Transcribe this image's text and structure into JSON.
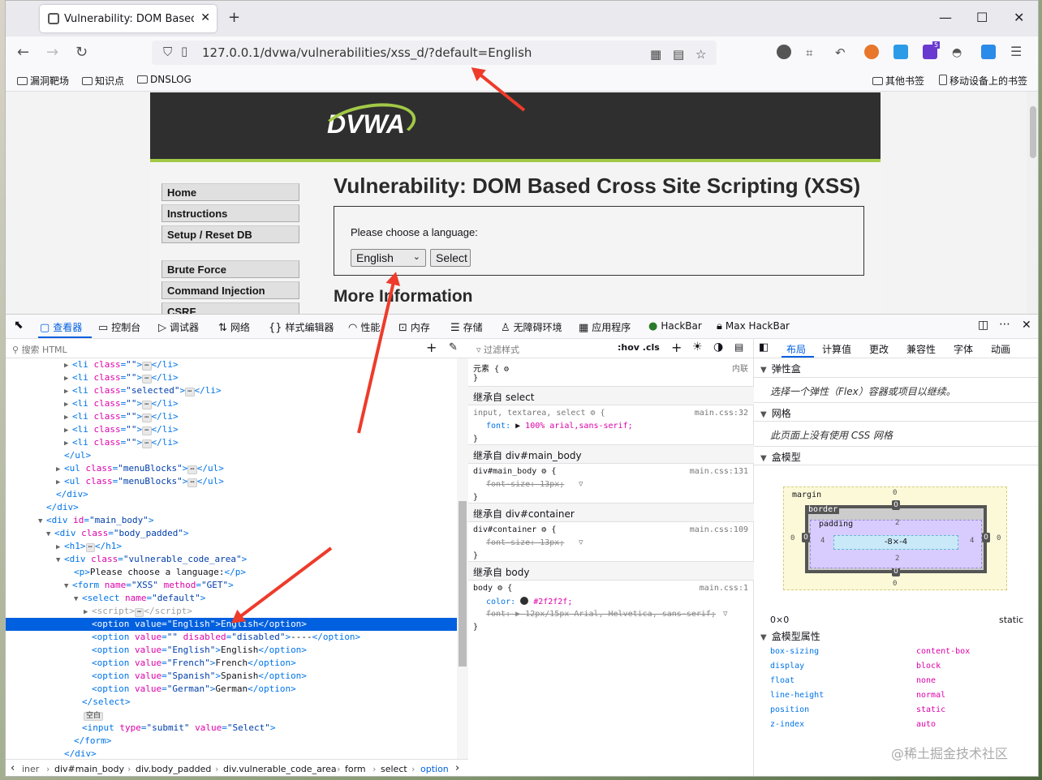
{
  "browser": {
    "tab_title": "Vulnerability: DOM Based Cross Site Scripting (XSS)",
    "url": "127.0.0.1/dvwa/vulnerabilities/xss_d/?default=English",
    "bookmarks": [
      "漏洞靶场",
      "知识点",
      "DNSLOG"
    ],
    "bookmarks_right": [
      "其他书签",
      "移动设备上的书签"
    ],
    "ext_badge": "5"
  },
  "dvwa": {
    "logo": "DVWA",
    "menu": [
      "Home",
      "Instructions",
      "Setup / Reset DB",
      "Brute Force",
      "Command Injection",
      "CSRF"
    ],
    "heading": "Vulnerability: DOM Based Cross Site Scripting (XSS)",
    "prompt": "Please choose a language:",
    "select_value": "English",
    "select_button": "Select",
    "more_info": "More Information"
  },
  "devtools": {
    "tabs": [
      "查看器",
      "控制台",
      "调试器",
      "网络",
      "样式编辑器",
      "性能",
      "内存",
      "存储",
      "无障碍环境",
      "应用程序",
      "HackBar",
      "Max HackBar"
    ],
    "search_placeholder": "搜索 HTML",
    "tree": [
      {
        "indent": 7,
        "tri": "▶",
        "html": "li_class_empty"
      },
      {
        "indent": 7,
        "tri": "▶",
        "html": "li_class_empty"
      },
      {
        "indent": 7,
        "tri": "▶",
        "html": "li_class_selected"
      },
      {
        "indent": 7,
        "tri": "▶",
        "html": "li_class_empty"
      },
      {
        "indent": 7,
        "tri": "▶",
        "html": "li_class_empty"
      },
      {
        "indent": 7,
        "tri": "▶",
        "html": "li_class_empty"
      },
      {
        "indent": 7,
        "tri": "▶",
        "html": "li_class_empty"
      }
    ],
    "tree_lines": [
      "<li class=\"\">",
      "<li class=\"\">",
      "<li class=\"selected\">",
      "<li class=\"\">",
      "<li class=\"\">",
      "<li class=\"\">",
      "<li class=\"\">",
      "</ul>",
      "<ul class=\"menuBlocks\">",
      "<ul class=\"menuBlocks\">",
      "</div>",
      "</div>",
      "<div id=\"main_body\">",
      "<div class=\"body_padded\">",
      "<h1>",
      "<div class=\"vulnerable_code_area\">",
      "<p>Please choose a language:</p>",
      "<form name=\"XSS\" method=\"GET\">",
      "<select name=\"default\">",
      "<script>",
      "<option value=\"English\">English</option>",
      "<option value=\"\" disabled=\"disabled\">----</option>",
      "<option value=\"English\">English</option>",
      "<option value=\"French\">French</option>",
      "<option value=\"Spanish\">Spanish</option>",
      "<option value=\"German\">German</option>",
      "</select>",
      "空白",
      "<input type=\"submit\" value=\"Select\">",
      "</form>",
      "</div>"
    ],
    "breadcrumbs": [
      "iner",
      "div#main_body",
      "div.body_padded",
      "div.vulnerable_code_area",
      "form",
      "select",
      "option"
    ],
    "rules_filter": "过滤样式",
    "rules_hov": ":hov .cls",
    "rules": {
      "element_label": "元素",
      "element_src": "内联",
      "inh1": "继承自 select",
      "r1_sel": "input, textarea, select",
      "r1_src": "main.css:32",
      "r1_prop": "font:",
      "r1_val": "100% arial,sans-serif;",
      "inh2": "继承自 div#main_body",
      "r2_sel": "div#main_body",
      "r2_src": "main.css:131",
      "r2_decl": "font-size: 13px;",
      "inh3": "继承自 div#container",
      "r3_sel": "div#container",
      "r3_src": "main.css:109",
      "r3_decl": "font-size: 13px;",
      "inh4": "继承自 body",
      "r4_sel": "body",
      "r4_src": "main.css:1",
      "r4_prop": "color:",
      "r4_val": "#2f2f2f;",
      "r4_font": "font:",
      "r4_fontval": "12px/15px Arial, Helvetica, sans-serif;"
    },
    "layout": {
      "tabs": [
        "布局",
        "计算值",
        "更改",
        "兼容性",
        "字体",
        "动画"
      ],
      "flex": "弹性盒",
      "flex_note": "选择一个弹性（Flex）容器或项目以继续。",
      "grid": "网格",
      "grid_note": "此页面上没有使用 CSS 网格",
      "boxmodel": "盒模型",
      "margin": "margin",
      "border": "border",
      "padding": "padding",
      "content": "-8×-4",
      "m_top": "0",
      "m_bot": "0",
      "m_left": "0",
      "m_right": "0",
      "b_top": "0",
      "b_bot": "0",
      "b_left": "0",
      "b_right": "0",
      "p_top": "2",
      "p_bot": "2",
      "p_left": "4",
      "p_right": "4",
      "size": "0×0",
      "position": "static",
      "props_title": "盒模型属性",
      "props": [
        [
          "box-sizing",
          "content-box"
        ],
        [
          "display",
          "block"
        ],
        [
          "float",
          "none"
        ],
        [
          "line-height",
          "normal"
        ],
        [
          "position",
          "static"
        ],
        [
          "z-index",
          "auto"
        ]
      ]
    },
    "watermark": "@稀土掘金技术社区"
  }
}
